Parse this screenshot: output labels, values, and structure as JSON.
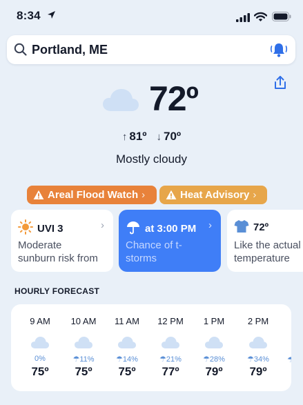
{
  "status_bar": {
    "time": "8:34"
  },
  "search": {
    "value": "Portland, ME"
  },
  "current": {
    "temp": "72º",
    "high": "81º",
    "low": "70º",
    "condition": "Mostly cloudy"
  },
  "alerts": [
    {
      "label": "Areal Flood Watch",
      "color": "#e8823a"
    },
    {
      "label": "Heat Advisory",
      "color": "#e7a64a"
    }
  ],
  "cards": {
    "uv": {
      "title": "UVI 3",
      "desc_line1": "Moderate",
      "desc_line2": "sunburn risk from"
    },
    "rain": {
      "title": "at 3:00 PM",
      "desc_line1": "Chance of t-",
      "desc_line2": "storms"
    },
    "feels": {
      "title": "72º",
      "desc_line1": "Like the actual",
      "desc_line2": "temperature"
    }
  },
  "hourly": {
    "title": "HOURLY FORECAST",
    "hours": [
      {
        "time": "9 AM",
        "precip": "0%",
        "temp": "75º"
      },
      {
        "time": "10 AM",
        "precip": "☂11%",
        "temp": "75º"
      },
      {
        "time": "11 AM",
        "precip": "☂14%",
        "temp": "75º"
      },
      {
        "time": "12 PM",
        "precip": "☂21%",
        "temp": "77º"
      },
      {
        "time": "1 PM",
        "precip": "☂28%",
        "temp": "79º"
      },
      {
        "time": "2 PM",
        "precip": "☂34%",
        "temp": "79º"
      }
    ]
  },
  "colors": {
    "accent": "#3f7ef7",
    "background": "#e9f0f8",
    "cloud": "#cfe0f5"
  }
}
